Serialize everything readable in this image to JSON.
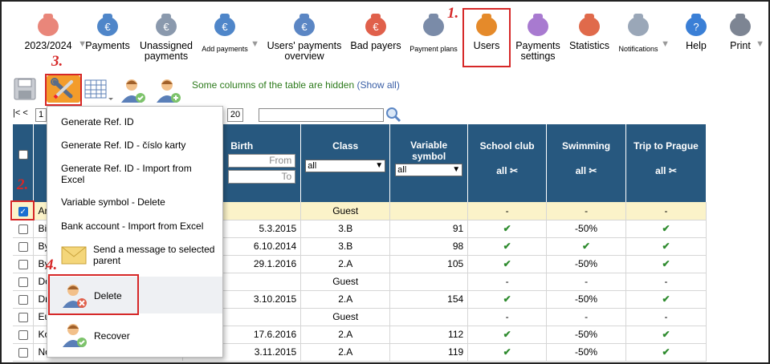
{
  "toolbar": [
    {
      "label": "2023/2024",
      "icon": "calendar-icon",
      "arrow": true
    },
    {
      "label": "Payments",
      "icon": "money-bag-icon"
    },
    {
      "label": "Unassigned payments",
      "icon": "unassigned-money-bag-icon"
    },
    {
      "label": "Add payments",
      "icon": "add-money-icon",
      "arrow": true,
      "small": true
    },
    {
      "label": "Users' payments overview",
      "icon": "euro-book-icon"
    },
    {
      "label": "Bad payers",
      "icon": "bad-payers-icon"
    },
    {
      "label": "Payment plans",
      "icon": "payment-plan-icon",
      "small": true
    },
    {
      "label": "Users",
      "icon": "user-icon"
    },
    {
      "label": "Payments settings",
      "icon": "gear-icon"
    },
    {
      "label": "Statistics",
      "icon": "pie-chart-icon"
    },
    {
      "label": "Notifications",
      "icon": "phone-icon",
      "arrow": true,
      "small": true
    },
    {
      "label": "Help",
      "icon": "help-icon"
    },
    {
      "label": "Print",
      "icon": "printer-icon",
      "arrow": true
    }
  ],
  "steps": [
    "1.",
    "2.",
    "3.",
    "4."
  ],
  "notice": {
    "text": "Some columns of the table are hidden",
    "link": "(Show all)"
  },
  "pager": {
    "first": "|<",
    "prev": "<",
    "page": "1",
    "per_page": "20"
  },
  "columns": {
    "birth": "Birth",
    "class": "Class",
    "vs": "Variable symbol",
    "club": "School club",
    "swim": "Swimming",
    "trip": "Trip to Prague"
  },
  "filters": {
    "from": "From",
    "to": "To",
    "all": "all"
  },
  "rows": [
    {
      "name": "Ar",
      "birth": "",
      "class": "Guest",
      "vs": "",
      "club": "-",
      "swim": "-",
      "trip": "-",
      "checked": true,
      "guest": true
    },
    {
      "name": "Bi",
      "birth": "5.3.2015",
      "class": "3.B",
      "vs": "91",
      "club": "✔",
      "swim": "-50%",
      "trip": "✔"
    },
    {
      "name": "By",
      "birth": "6.10.2014",
      "class": "3.B",
      "vs": "98",
      "club": "✔",
      "swim": "✔",
      "trip": "✔"
    },
    {
      "name": "By",
      "birth": "29.1.2016",
      "class": "2.A",
      "vs": "105",
      "club": "✔",
      "swim": "-50%",
      "trip": "✔"
    },
    {
      "name": "Do",
      "birth": "",
      "class": "Guest",
      "vs": "",
      "club": "-",
      "swim": "-",
      "trip": "-"
    },
    {
      "name": "Dr",
      "birth": "3.10.2015",
      "class": "2.A",
      "vs": "154",
      "club": "✔",
      "swim": "-50%",
      "trip": "✔"
    },
    {
      "name": "Eu",
      "birth": "",
      "class": "Guest",
      "vs": "",
      "club": "-",
      "swim": "-",
      "trip": "-"
    },
    {
      "name": "Ko",
      "birth": "17.6.2016",
      "class": "2.A",
      "vs": "112",
      "club": "✔",
      "swim": "-50%",
      "trip": "✔"
    },
    {
      "name": "No",
      "birth": "3.11.2015",
      "class": "2.A",
      "vs": "119",
      "club": "✔",
      "swim": "-50%",
      "trip": "✔"
    }
  ],
  "menu": {
    "gen_ref": "Generate Ref. ID",
    "gen_ref_card": "Generate Ref. ID - číslo karty",
    "gen_ref_import": "Generate Ref. ID - Import from Excel",
    "vs_delete": "Variable symbol - Delete",
    "bank_import": "Bank account - Import from Excel",
    "send_message": "Send a message to selected parent",
    "delete": "Delete",
    "recover": "Recover"
  }
}
